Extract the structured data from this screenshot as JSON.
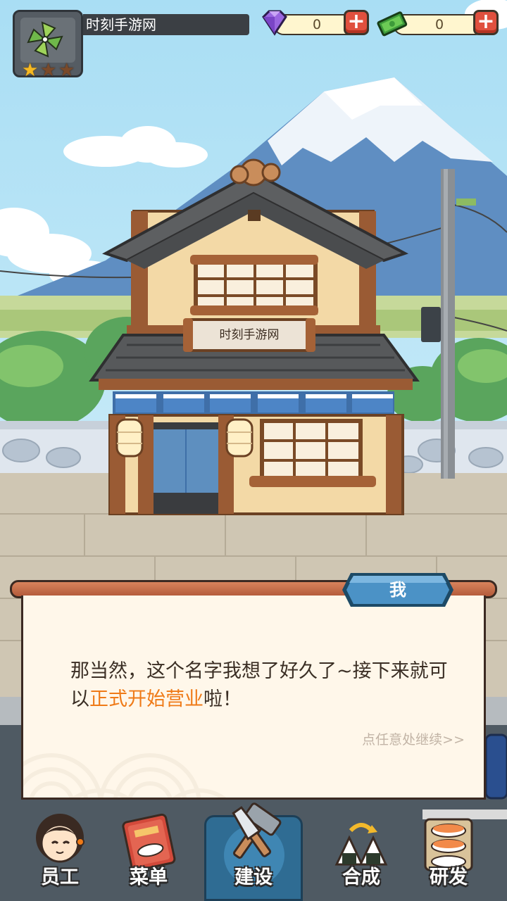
{
  "player": {
    "name": "时刻手游网",
    "stars_total": 3,
    "stars_earned": 1
  },
  "currencies": {
    "gems": {
      "value": "0",
      "icon": "purple-gem-icon"
    },
    "cash": {
      "value": "0",
      "icon": "cash-bills-icon"
    }
  },
  "shop": {
    "sign": "时刻手游网"
  },
  "dialog": {
    "speaker": "我",
    "text_before": "那当然，这个名字我想了好久了~接下来就可以",
    "text_highlight": "正式开始营业",
    "text_after": "啦！",
    "continue_hint": "点任意处继续>>"
  },
  "nav": {
    "items": [
      {
        "label": "员工",
        "icon": "staff-girl-icon",
        "active": false
      },
      {
        "label": "菜单",
        "icon": "menu-book-icon",
        "active": false
      },
      {
        "label": "建设",
        "icon": "hammer-saw-icon",
        "active": true
      },
      {
        "label": "合成",
        "icon": "onigiri-combine-icon",
        "active": false
      },
      {
        "label": "研发",
        "icon": "sushi-tray-icon",
        "active": false
      }
    ]
  },
  "colors": {
    "sky": "#bfe8f7",
    "accent_orange": "#ef7a17",
    "tag_blue": "#3f86b3",
    "plus_red": "#e0503e"
  }
}
